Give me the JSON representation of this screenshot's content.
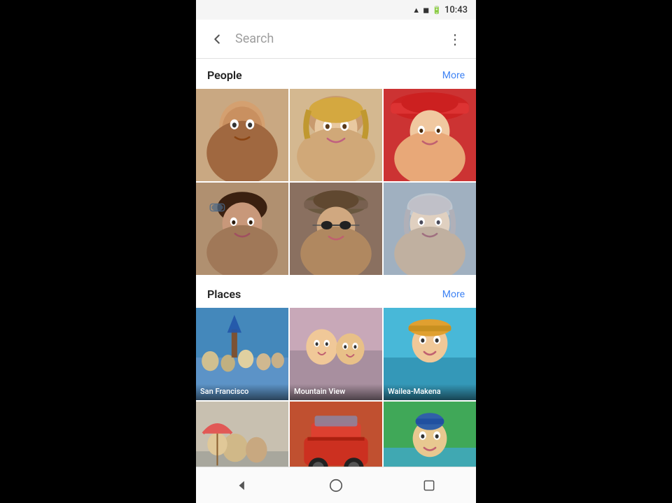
{
  "statusBar": {
    "time": "10:43",
    "wifiIcon": "▲",
    "signalIcon": "▐",
    "batteryIcon": "▮"
  },
  "searchBar": {
    "backIcon": "←",
    "placeholder": "Search",
    "menuIcon": "⋮"
  },
  "sections": {
    "people": {
      "title": "People",
      "moreLabel": "More",
      "rows": [
        [
          {
            "id": "p1",
            "label": ""
          },
          {
            "id": "p2",
            "label": ""
          },
          {
            "id": "p3",
            "label": ""
          }
        ],
        [
          {
            "id": "p4",
            "label": ""
          },
          {
            "id": "p5",
            "label": ""
          },
          {
            "id": "p6",
            "label": ""
          }
        ]
      ]
    },
    "places": {
      "title": "Places",
      "moreLabel": "More",
      "rows": [
        [
          {
            "id": "pl1",
            "label": "San Francisco"
          },
          {
            "id": "pl2",
            "label": "Mountain View"
          },
          {
            "id": "pl3",
            "label": "Wailea-Makena"
          }
        ],
        [
          {
            "id": "pl4",
            "label": ""
          },
          {
            "id": "pl5",
            "label": ""
          },
          {
            "id": "pl6",
            "label": ""
          }
        ]
      ]
    }
  },
  "navBar": {
    "backIcon": "◁",
    "homeIcon": "○",
    "recentIcon": "□"
  }
}
